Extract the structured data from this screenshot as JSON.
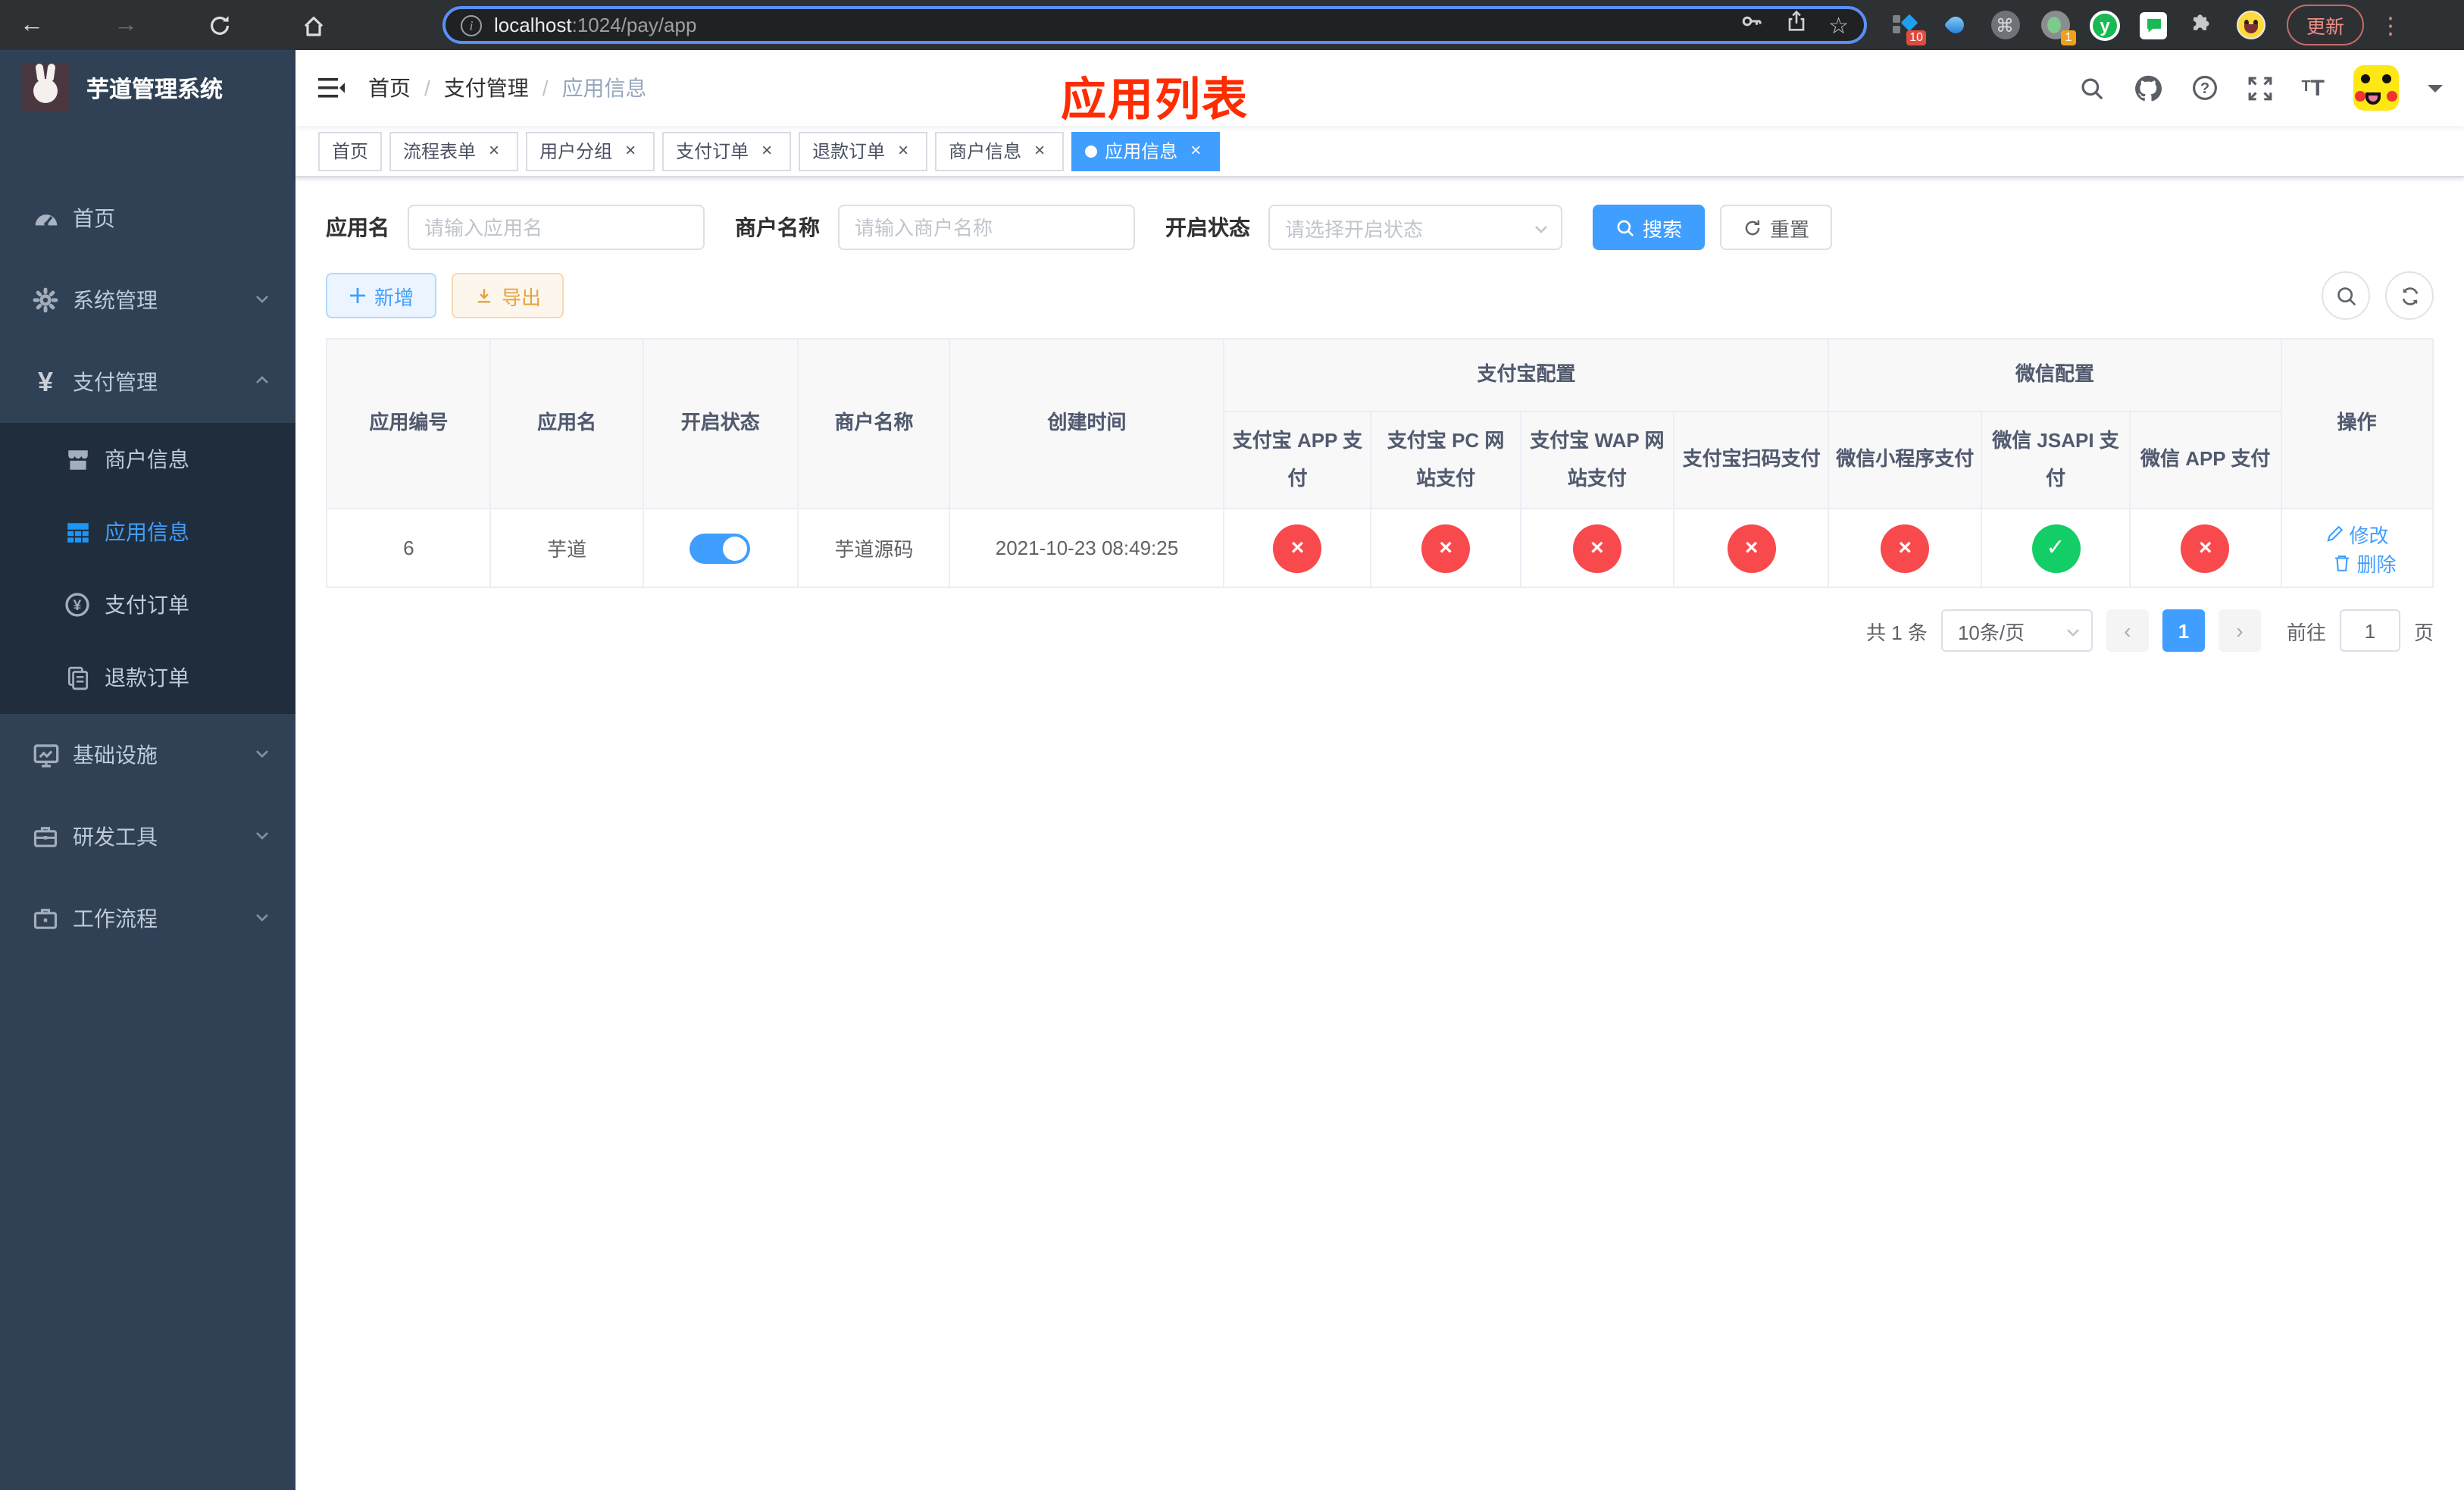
{
  "browser": {
    "url": {
      "host": "localhost",
      "path": ":1024/pay/app"
    },
    "update_button": "更新",
    "extensions": {
      "blue_badge": "10",
      "avatar_badge": "1",
      "y_letter": "y"
    }
  },
  "icons": {
    "back": "←",
    "forward": "→",
    "star": "☆",
    "command": "⌘",
    "dots": "⋮",
    "info": "i",
    "question": "?",
    "check": "✓",
    "cross": "×",
    "prev": "‹",
    "next": "›",
    "plus": "＋"
  },
  "colors": {
    "accent": "#409eff",
    "success": "#13ce66",
    "danger": "#f8494d",
    "warning": "#e6a23c",
    "sidebar_bg": "#304156",
    "submenu_bg": "#1f2d3d",
    "annotation": "#fe2c00"
  },
  "sidebar": {
    "logo_title": "芋道管理系统",
    "menu": [
      {
        "label": "首页"
      },
      {
        "label": "系统管理"
      },
      {
        "label": "支付管理"
      },
      {
        "label": "商户信息"
      },
      {
        "label": "应用信息"
      },
      {
        "label": "支付订单"
      },
      {
        "label": "退款订单"
      },
      {
        "label": "基础设施"
      },
      {
        "label": "研发工具"
      },
      {
        "label": "工作流程"
      }
    ]
  },
  "navbar": {
    "breadcrumb": [
      "首页",
      "支付管理",
      "应用信息"
    ]
  },
  "annotation": {
    "title": "应用列表"
  },
  "tabs": [
    {
      "label": "首页"
    },
    {
      "label": "流程表单"
    },
    {
      "label": "用户分组"
    },
    {
      "label": "支付订单"
    },
    {
      "label": "退款订单"
    },
    {
      "label": "商户信息"
    },
    {
      "label": "应用信息"
    }
  ],
  "filters": {
    "app_name_label": "应用名",
    "app_name_placeholder": "请输入应用名",
    "merchant_label": "商户名称",
    "merchant_placeholder": "请输入商户名称",
    "status_label": "开启状态",
    "status_placeholder": "请选择开启状态",
    "search_button": "搜索",
    "reset_button": "重置"
  },
  "toolbar": {
    "add_button": "新增",
    "export_button": "导出"
  },
  "table": {
    "headers": {
      "app_id": "应用编号",
      "app_name": "应用名",
      "status": "开启状态",
      "merchant": "商户名称",
      "create_time": "创建时间",
      "alipay_group": "支付宝配置",
      "wechat_group": "微信配置",
      "alipay_app": "支付宝 APP 支付",
      "alipay_pc": "支付宝 PC 网站支付",
      "alipay_wap": "支付宝 WAP 网站支付",
      "alipay_qr": "支付宝扫码支付",
      "wx_lite": "微信小程序支付",
      "wx_jsapi": "微信 JSAPI 支付",
      "wx_app": "微信 APP 支付",
      "actions": "操作"
    },
    "rows": [
      {
        "app_id": "6",
        "app_name": "芋道",
        "enabled": true,
        "merchant": "芋道源码",
        "create_time": "2021-10-23 08:49:25",
        "channels": {
          "alipay_app": false,
          "alipay_pc": false,
          "alipay_wap": false,
          "alipay_qr": false,
          "wx_lite": false,
          "wx_jsapi": true,
          "wx_app": false
        },
        "edit_label": "修改",
        "delete_label": "删除"
      }
    ]
  },
  "pagination": {
    "total": "共 1 条",
    "page_size": "10条/页",
    "current_page": "1",
    "goto_label": "前往",
    "goto_value": "1",
    "page_suffix": "页"
  }
}
